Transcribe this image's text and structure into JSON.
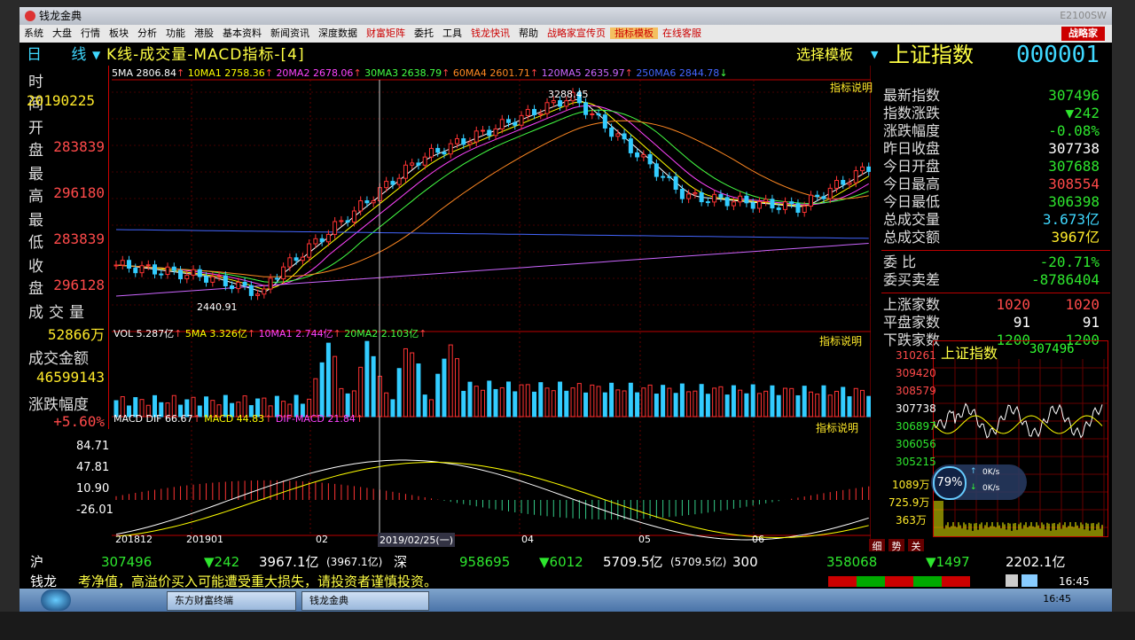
{
  "window": {
    "title": "钱龙金典",
    "code": "E2100SW"
  },
  "menu": [
    "系统",
    "大盘",
    "行情",
    "板块",
    "分析",
    "功能",
    "港股",
    "基本资料",
    "新闻资讯",
    "深度数据",
    "财富矩阵",
    "委托",
    "工具",
    "钱龙快讯",
    "帮助",
    "战略家宣传页",
    "指标模板",
    "在线客服"
  ],
  "menu_button": "战略家",
  "header": {
    "period": "日 线",
    "chart_title": "K线-成交量-MACD指标-[4]",
    "select_template": "选择模板",
    "index_name": "上证指数",
    "index_code": "000001"
  },
  "left_panel": {
    "time_label": "时 间",
    "time_value": "20190225",
    "open_label": "开 盘",
    "open_value": "283839",
    "high_label": "最 高",
    "high_value": "296180",
    "low_label": "最 低",
    "low_value": "283839",
    "close_label": "收 盘",
    "close_value": "296128",
    "volume_label": "成交量",
    "volume_value": "52866万",
    "amount_label": "成交金额",
    "amount_value": "46599143",
    "change_label": "涨跌幅度",
    "change_value": "+5.60%"
  },
  "ma_legend": [
    {
      "text": "5MA 2806.84",
      "color": "#ffffff"
    },
    {
      "text": "10MA1 2758.36",
      "color": "#ffff00"
    },
    {
      "text": "20MA2 2678.06",
      "color": "#ff40ff"
    },
    {
      "text": "30MA3 2638.79",
      "color": "#40ff40"
    },
    {
      "text": "60MA4 2601.71",
      "color": "#ff8020"
    },
    {
      "text": "120MA5 2635.97",
      "color": "#c060ff"
    },
    {
      "text": "250MA6 2844.78",
      "color": "#4060ff"
    }
  ],
  "kline_labels": {
    "high_mark": "3288.45",
    "low_mark": "2440.91",
    "note": "指标说明"
  },
  "vol_legend": [
    {
      "text": "VOL 5.287亿",
      "color": "#ffffff"
    },
    {
      "text": "5MA 3.326亿",
      "color": "#ffff00"
    },
    {
      "text": "10MA1 2.744亿",
      "color": "#ff40ff"
    },
    {
      "text": "20MA2 2.103亿",
      "color": "#40ff40"
    }
  ],
  "macd_legend": [
    {
      "text": "MACD DIF 66.67",
      "color": "#ffffff"
    },
    {
      "text": "MACD 44.83",
      "color": "#ffff00"
    },
    {
      "text": "DIF-MACD 21.84",
      "color": "#ff40ff"
    }
  ],
  "macd_axis": [
    "84.71",
    "47.81",
    "10.90",
    "-26.01"
  ],
  "time_axis": [
    "201812",
    "201901",
    "02",
    "2019/02/25(一)",
    "04",
    "05",
    "06"
  ],
  "right_panel": [
    {
      "k": "最新指数",
      "v": "307496",
      "c": "green"
    },
    {
      "k": "指数涨跌",
      "v": "▼242",
      "c": "green"
    },
    {
      "k": "涨跌幅度",
      "v": "-0.08%",
      "c": "green"
    },
    {
      "k": "昨日收盘",
      "v": "307738",
      "c": "white"
    },
    {
      "k": "今日开盘",
      "v": "307688",
      "c": "green"
    },
    {
      "k": "今日最高",
      "v": "308554",
      "c": "red"
    },
    {
      "k": "今日最低",
      "v": "306398",
      "c": "green"
    },
    {
      "k": "总成交量",
      "v": "3.673亿",
      "c": "cyan"
    },
    {
      "k": "总成交额",
      "v": "3967亿",
      "c": "yellow"
    },
    {
      "k": "委 比",
      "v": "-20.71%",
      "c": "green"
    },
    {
      "k": "委买卖差",
      "v": "-8786404",
      "c": "green"
    }
  ],
  "breadth": [
    {
      "k": "上涨家数",
      "v1": "1020",
      "v2": "1020",
      "c": "red"
    },
    {
      "k": "平盘家数",
      "v1": "91",
      "v2": "91",
      "c": "white"
    },
    {
      "k": "下跌家数",
      "v1": "1200",
      "v2": "1200",
      "c": "green"
    }
  ],
  "mini": {
    "title": "上证指数",
    "price": "307496",
    "axis": [
      "310261",
      "309420",
      "308579",
      "307738",
      "306897",
      "306056",
      "305215"
    ],
    "vol_axis": [
      "1089万",
      "725.9万",
      "363万"
    ],
    "cpu": "79%",
    "net_up": "0K/s",
    "net_down": "0K/s",
    "tabs": [
      "细",
      "势",
      "关"
    ]
  },
  "status": {
    "sh_label": "沪",
    "sh_index": "307496",
    "sh_change": "▼242",
    "sh_amount": "3967.1亿",
    "sh_amount2": "(3967.1亿)",
    "sz_label": "深",
    "sz_index": "958695",
    "sz_change": "▼6012",
    "sz_amount": "5709.5亿",
    "sz_amount2": "(5709.5亿)",
    "cy_label": "300",
    "cy_index": "358068",
    "cy_change": "▼1497",
    "cy_amount": "2202.1亿"
  },
  "ticker": {
    "label": "钱龙",
    "text": "考净值，高溢价买入可能遭受重大损失，请投资者谨慎投资。",
    "time": "16:45"
  },
  "taskbar": {
    "task1": "东方财富终端",
    "task2": "钱龙金典",
    "clock": "16:45"
  }
}
